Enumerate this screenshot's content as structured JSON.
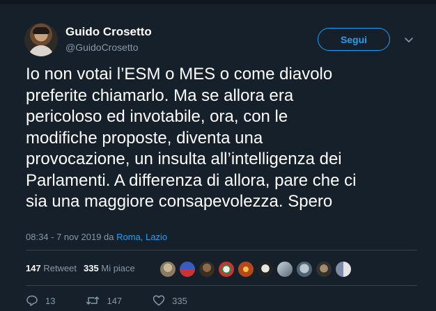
{
  "author": {
    "name": "Guido Crosetto",
    "handle": "@GuidoCrosetto"
  },
  "follow_label": "Segui",
  "tweet_text": "Io non votai l’ESM o MES o come diavolo\npreferite chiamarlo. Ma se allora era\npericoloso ed invotabile, ora, con le\nmodifiche proposte, diventa una\nprovocazione, un insulta all’intelligenza dei\nParlamenti. A differenza di allora, pare che ci\nsia una maggiore consapevolezza. Spero",
  "meta": {
    "time": "08:34 - 7 nov 2019 da ",
    "location": "Roma, Lazio"
  },
  "stats": {
    "retweets_count": "147",
    "retweets_label": "Retweet",
    "likes_count": "335",
    "likes_label": "Mi piace"
  },
  "likers": [
    "liker-avatar-1",
    "liker-avatar-2",
    "liker-avatar-3",
    "liker-avatar-4",
    "liker-avatar-5",
    "liker-avatar-6",
    "liker-avatar-7",
    "liker-avatar-8",
    "liker-avatar-9",
    "liker-avatar-10"
  ],
  "actions": {
    "replies": "13",
    "retweets": "147",
    "likes": "335"
  },
  "colors": {
    "background": "#15202b",
    "accent": "#1da1f2",
    "muted": "#8899a6",
    "divider": "#38444d"
  }
}
